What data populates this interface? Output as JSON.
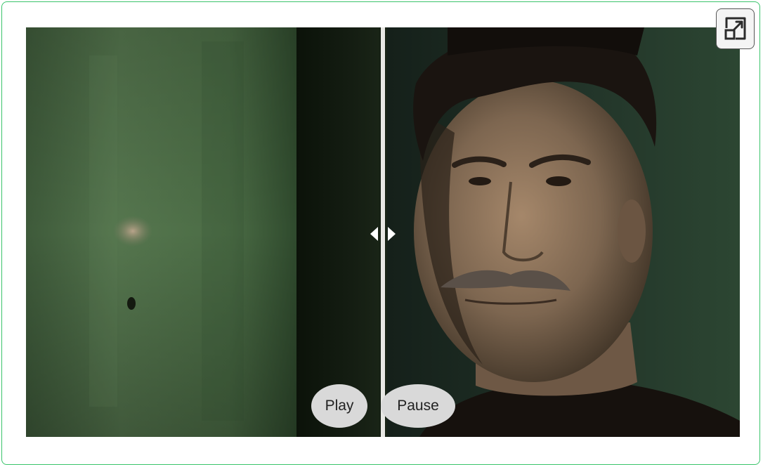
{
  "viewer": {
    "play_label": "Play",
    "pause_label": "Pause",
    "split_position": 0.5
  },
  "colors": {
    "frame_border": "#39c46a",
    "button_fill": "#d9d9d9",
    "divider": "#e8e8e4"
  },
  "icons": {
    "fullscreen": "expand-icon",
    "handle": "left-right-arrows-icon"
  }
}
